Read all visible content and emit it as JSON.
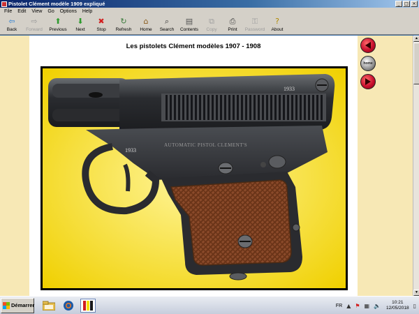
{
  "window": {
    "title": "Pistolet Clément modèle 1909 expliqué"
  },
  "menu": [
    "File",
    "Edit",
    "View",
    "Go",
    "Options",
    "Help"
  ],
  "toolbar": [
    {
      "label": "Back",
      "icon": "back-arrow-icon",
      "glyph": "⇦",
      "color": "#2a7fd4",
      "enabled": true
    },
    {
      "label": "Forward",
      "icon": "forward-arrow-icon",
      "glyph": "⇨",
      "color": "#9a9a9a",
      "enabled": false
    },
    {
      "label": "Previous",
      "icon": "previous-arrow-icon",
      "glyph": "⬆",
      "color": "#2e9a2e",
      "enabled": true
    },
    {
      "label": "Next",
      "icon": "next-arrow-icon",
      "glyph": "⬇",
      "color": "#2e9a2e",
      "enabled": true
    },
    {
      "label": "Stop",
      "icon": "stop-icon",
      "glyph": "✖",
      "color": "#d21f1f",
      "enabled": true
    },
    {
      "label": "Refresh",
      "icon": "refresh-icon",
      "glyph": "↻",
      "color": "#3a7a3a",
      "enabled": true
    },
    {
      "label": "Home",
      "icon": "home-icon",
      "glyph": "⌂",
      "color": "#8a5a1a",
      "enabled": true
    },
    {
      "label": "Search",
      "icon": "search-icon",
      "glyph": "⌕",
      "color": "#333333",
      "enabled": true
    },
    {
      "label": "Contents",
      "icon": "contents-icon",
      "glyph": "▤",
      "color": "#555555",
      "enabled": true
    },
    {
      "label": "Copy",
      "icon": "copy-icon",
      "glyph": "⧉",
      "color": "#a0a0a0",
      "enabled": false
    },
    {
      "label": "Print",
      "icon": "print-icon",
      "glyph": "⎙",
      "color": "#444444",
      "enabled": true
    },
    {
      "label": "Password",
      "icon": "password-key-icon",
      "glyph": "⚿",
      "color": "#a0a0a0",
      "enabled": false
    },
    {
      "label": "About",
      "icon": "about-icon",
      "glyph": "?",
      "color": "#b08a00",
      "enabled": true
    }
  ],
  "page": {
    "title": "Les pistolets Clément modèles 1907 - 1908",
    "photo": {
      "serial_frame": "1933",
      "serial_slide": "1933",
      "inscription": "AUTOMATIC PISTOL CLEMENT'S"
    }
  },
  "side_nav": {
    "prev_icon": "previous-page-icon",
    "home_label": "home",
    "next_icon": "next-page-icon"
  },
  "taskbar": {
    "start_label": "Démarrer",
    "lang": "FR",
    "time": "10:21",
    "date": "12/05/2018"
  },
  "colors": {
    "page_bg": "#f7e8b5",
    "photo_bg": "#f5e000",
    "nav_red": "#c8102e"
  }
}
